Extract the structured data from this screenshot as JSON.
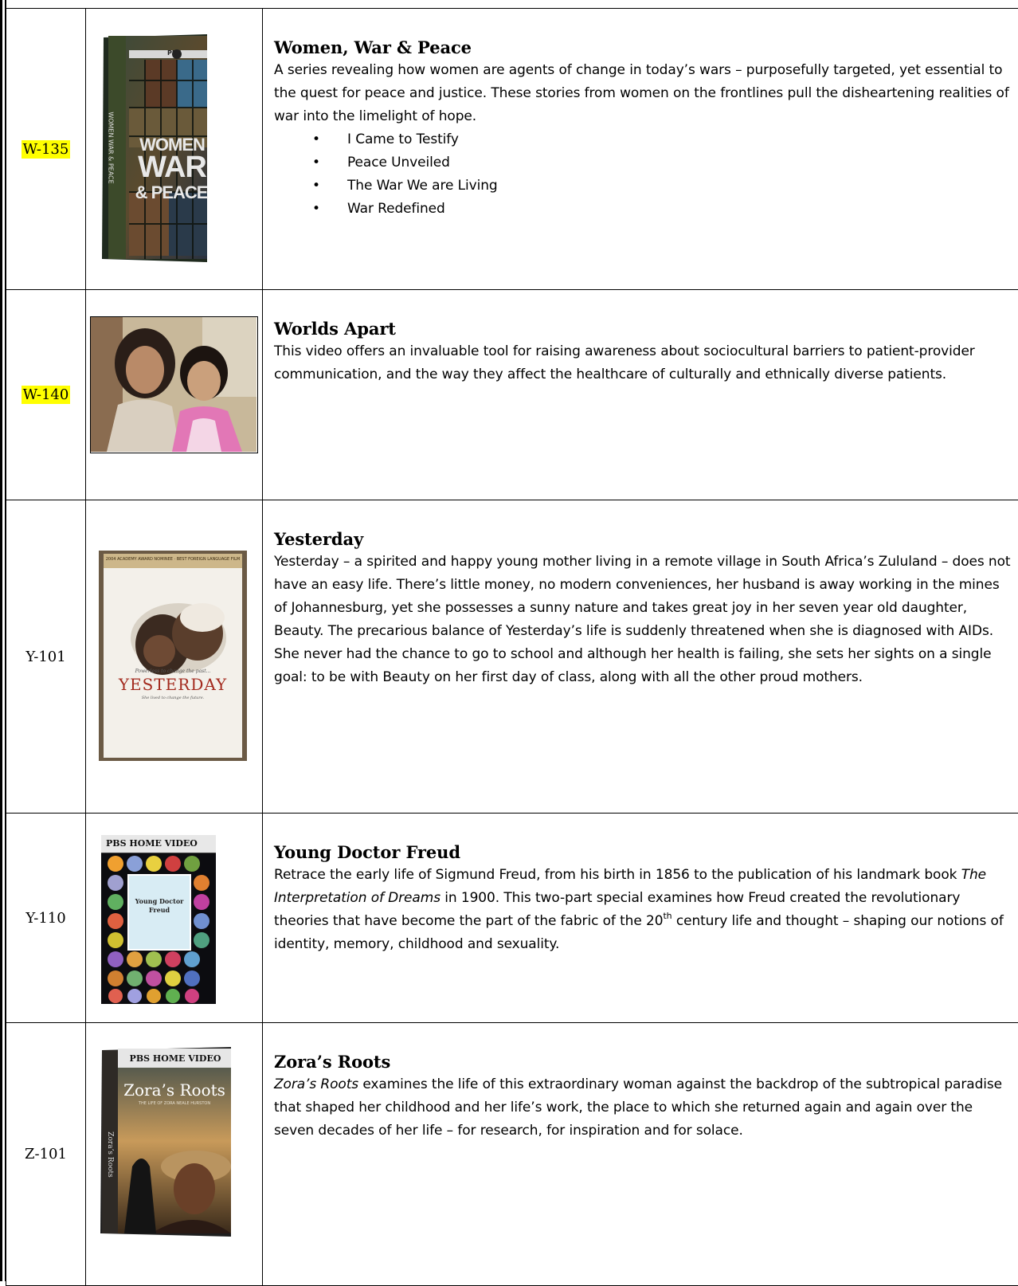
{
  "items": [
    {
      "code": "W-135",
      "highlighted": true,
      "title": "Women, War & Peace",
      "description": "A series revealing how women are agents of change in today’s wars – purposefully targeted, yet essential to the quest for peace and justice. These stories from women on the frontlines pull the disheartening realities of war into the limelight of hope.",
      "episodes": [
        "I Came to Testify",
        "Peace Unveiled",
        "The War We are Living",
        "War Redefined"
      ],
      "cover": {
        "brand": "PBS",
        "line1": "WOMEN",
        "line2": "WAR",
        "line3": "& PEACE",
        "spine": "WOMEN WAR & PEACE"
      }
    },
    {
      "code": "W-140",
      "highlighted": true,
      "title": "Worlds Apart",
      "description": "This video offers an invaluable tool for raising awareness about sociocultural barriers to patient-provider communication, and the way they affect the healthcare of culturally and ethnically diverse patients."
    },
    {
      "code": "Y-101",
      "highlighted": false,
      "title": "Yesterday",
      "description": "Yesterday – a spirited and happy young mother living in a remote village in South Africa’s Zululand – does not have an easy life. There’s little money, no modern conveniences, her husband is away working in the mines of Johannesburg, yet she possesses a sunny nature and takes great joy in her seven year old daughter, Beauty. The precarious balance of Yesterday’s life is suddenly threatened when she is diagnosed with AIDs. She never had the chance to go to school and although her health is failing, she sets her sights on a single goal: to be with Beauty on her first day of class, along with all the other proud mothers.",
      "cover": {
        "title": "YESTERDAY",
        "top_banner": "2004 ACADEMY AWARD NOMINEE · BEST FOREIGN LANGUAGE FILM",
        "tagline": "Powerless to change the past...",
        "subtag": "She lived to change the future."
      }
    },
    {
      "code": "Y-110",
      "highlighted": false,
      "title": "Young Doctor Freud",
      "description_before": "Retrace the early life of Sigmund Freud, from his birth in 1856 to the publication of his landmark book ",
      "description_italic": "The Interpretation of Dreams",
      "description_mid": " in 1900. This two-part special examines how Freud created the revolutionary theories that have become the part of the fabric of the 20",
      "description_sup": "th",
      "description_after": " century life and thought – shaping our notions of identity, memory, childhood and sexuality.",
      "cover": {
        "brand": "PBS HOME VIDEO",
        "label_line1": "Young Doctor",
        "label_line2": "Freud"
      }
    },
    {
      "code": "Z-101",
      "highlighted": false,
      "title": "Zora’s Roots",
      "description_italic": "Zora’s Roots",
      "description_after": " examines the life of this extraordinary woman against the backdrop of the subtropical paradise that shaped her childhood and her life’s work, the place to which she returned again and again over the seven decades of her life – for research, for inspiration and for solace.",
      "cover": {
        "brand": "PBS HOME VIDEO",
        "title": "Zora’s Roots",
        "subtitle": "THE LIFE OF ZORA NEALE HURSTON",
        "spine": "Zora’s Roots"
      }
    }
  ],
  "colors": {
    "highlight": "#ffff00",
    "border": "#000000"
  }
}
